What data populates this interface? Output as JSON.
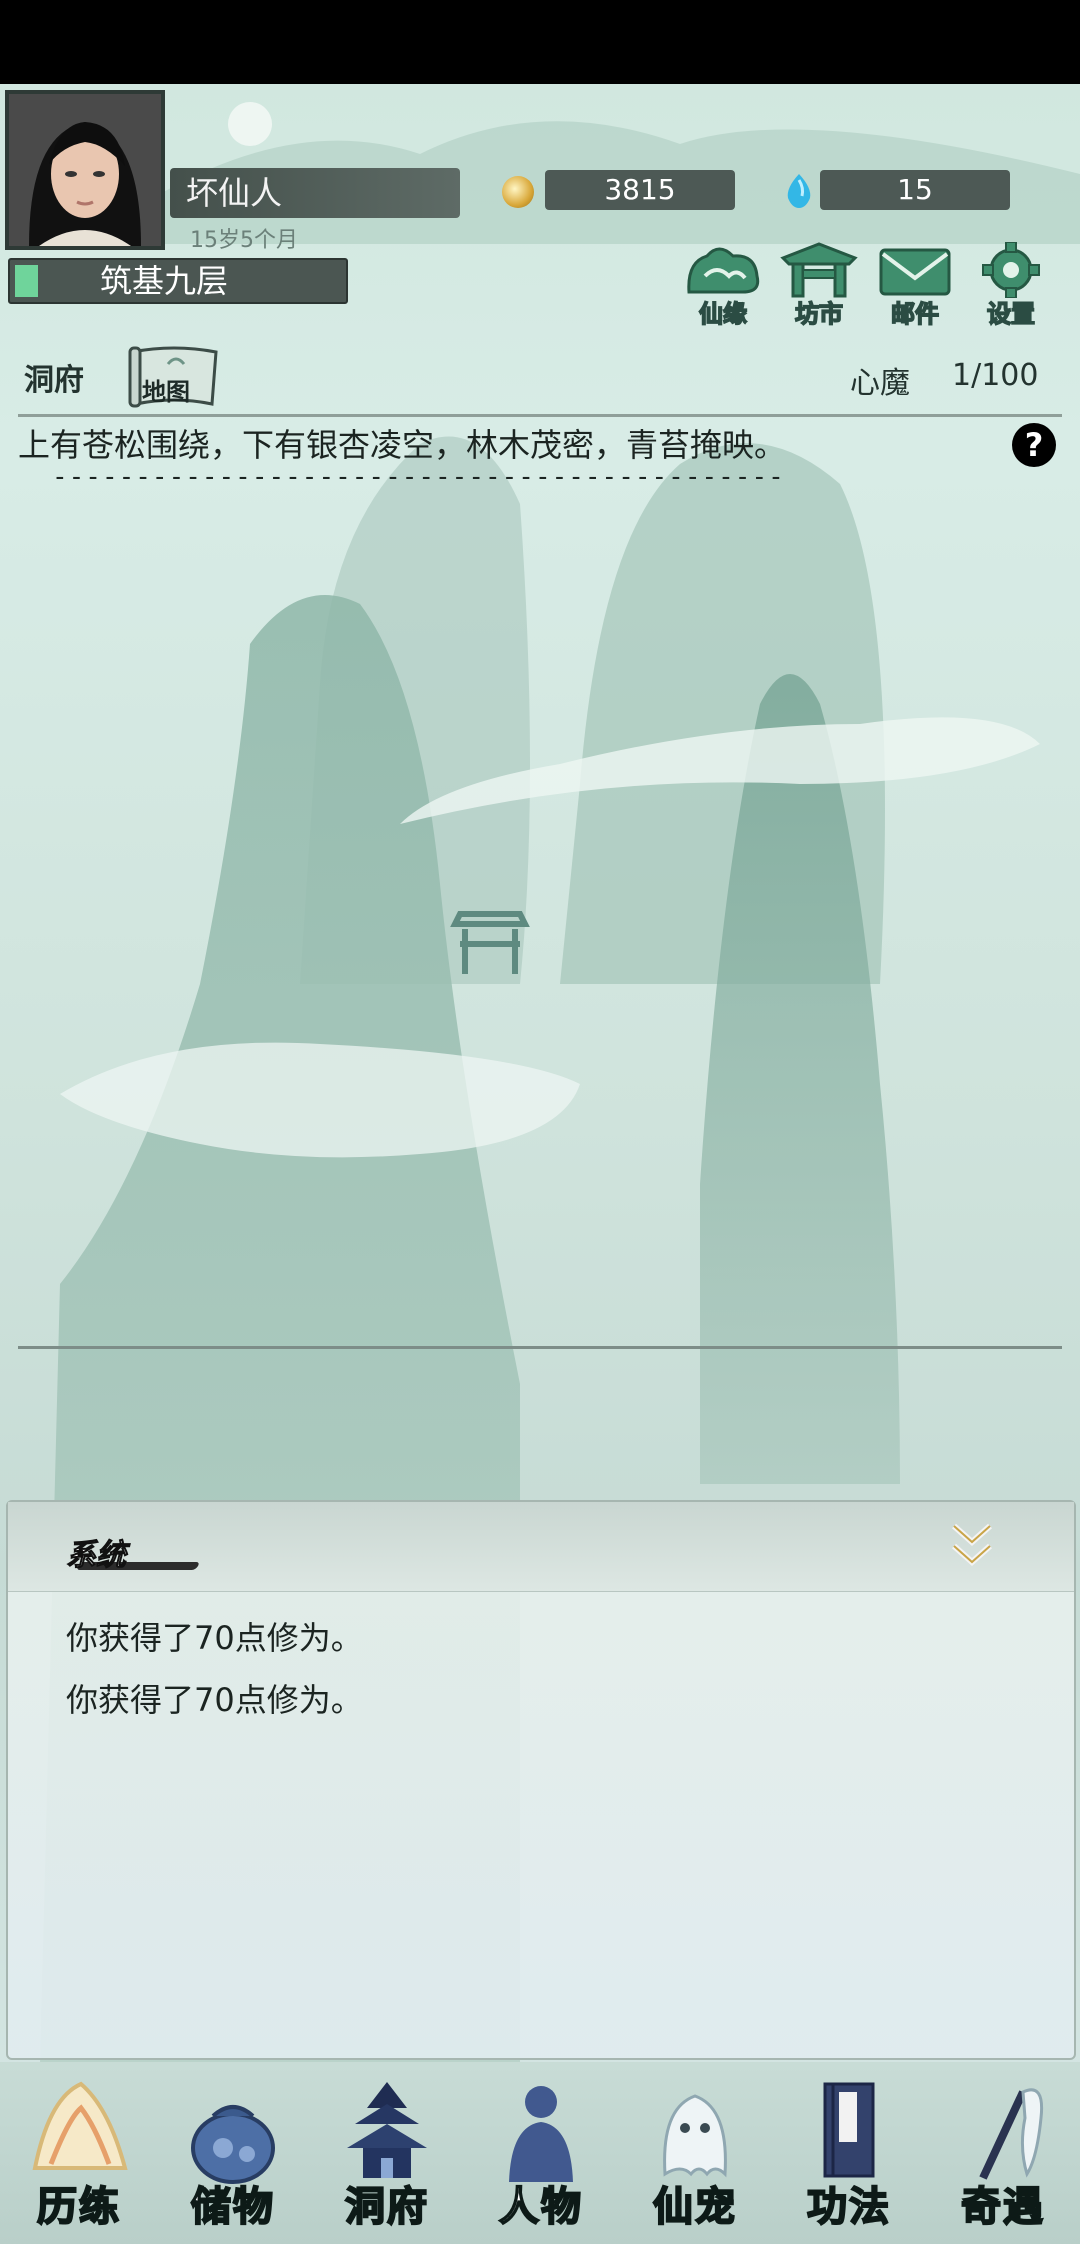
{
  "player": {
    "name": "坏仙人",
    "age": "15岁5个月",
    "realm": "筑基九层",
    "realm_progress": 0.07
  },
  "currency": {
    "coins": "3815",
    "gems": "15"
  },
  "top_menu": [
    {
      "label": "仙缘",
      "icon": "cloud-mountain-icon"
    },
    {
      "label": "坊市",
      "icon": "market-gate-icon"
    },
    {
      "label": "邮件",
      "icon": "mail-icon"
    },
    {
      "label": "设置",
      "icon": "gear-icon"
    }
  ],
  "location": {
    "title": "洞府",
    "map_label": "地图",
    "heart_demon_label": "心魔",
    "heart_demon_value": "1/100",
    "description": "上有苍松围绕，下有银杏凌空，林木茂密，青苔掩映。",
    "separator": "--------------------------------------------"
  },
  "system_log": {
    "title": "系统",
    "lines": [
      "你获得了70点修为。",
      "你获得了70点修为。"
    ]
  },
  "bottom_nav": [
    {
      "label": "历练",
      "icon": "mountain-scroll-icon",
      "active": true
    },
    {
      "label": "储物",
      "icon": "storage-bag-icon"
    },
    {
      "label": "洞府",
      "icon": "pagoda-icon"
    },
    {
      "label": "人物",
      "icon": "person-silhouette-icon"
    },
    {
      "label": "仙宠",
      "icon": "ghost-pet-icon"
    },
    {
      "label": "功法",
      "icon": "scroll-book-icon"
    },
    {
      "label": "奇遇",
      "icon": "brush-icon"
    }
  ],
  "colors": {
    "accent_green": "#6fd49b",
    "plate_dark": "#4d5955"
  }
}
